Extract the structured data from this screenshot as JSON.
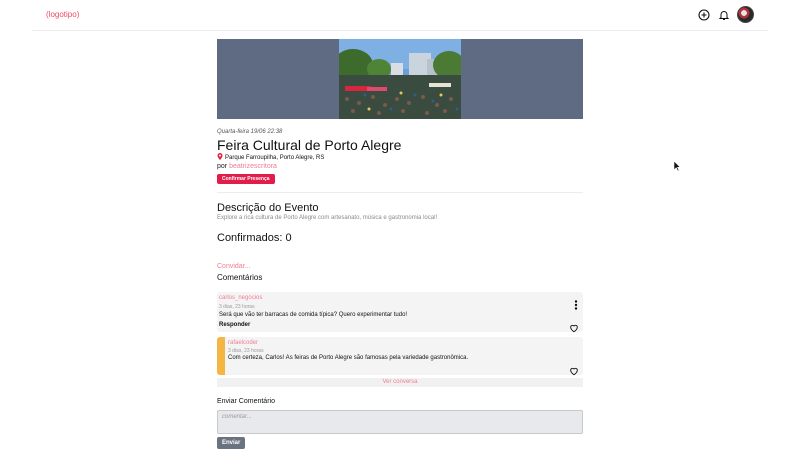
{
  "header": {
    "logo_text": "(logotipo)",
    "icons": [
      "add-circle-icon",
      "bell-icon",
      "avatar"
    ]
  },
  "event": {
    "date": "Quarta-feira 19/06 22:38",
    "title": "Feira Cultural de Porto Alegre",
    "location": "Parque Farroupilha, Porto Alegre, RS",
    "author_prefix": "por",
    "author": "beatrizescritora",
    "confirm_label": "Confirmar Presença"
  },
  "description": {
    "heading": "Descrição do Evento",
    "text": "Explore a rica cultura de Porto Alegre com artesanato, música e gastronomia local!"
  },
  "attendees": {
    "confirmed_label": "Confirmados: 0",
    "invite_label": "Convidar..."
  },
  "comments": {
    "heading": "Comentários",
    "items": [
      {
        "user": "carlos_negocios",
        "time": "3 dias, 23 horas",
        "text": "Será que vão ter barracas de comida típica? Quero experimentar tudo!",
        "reply_label": "Responder"
      },
      {
        "user": "rafaelcoder",
        "time": "3 dias, 23 horas",
        "text": "Com certeza, Carlos! As feiras de Porto Alegre são famosas pela variedade gastronômica."
      }
    ],
    "see_more_label": "Ver conversa"
  },
  "compose": {
    "heading": "Enviar Comentário",
    "placeholder": "comentar...",
    "send_label": "Enviar"
  },
  "colors": {
    "accent": "#ef8090",
    "primary_button": "#e21d4a",
    "hero_bg": "#5f6b82",
    "reply_bar": "#f3b642"
  }
}
